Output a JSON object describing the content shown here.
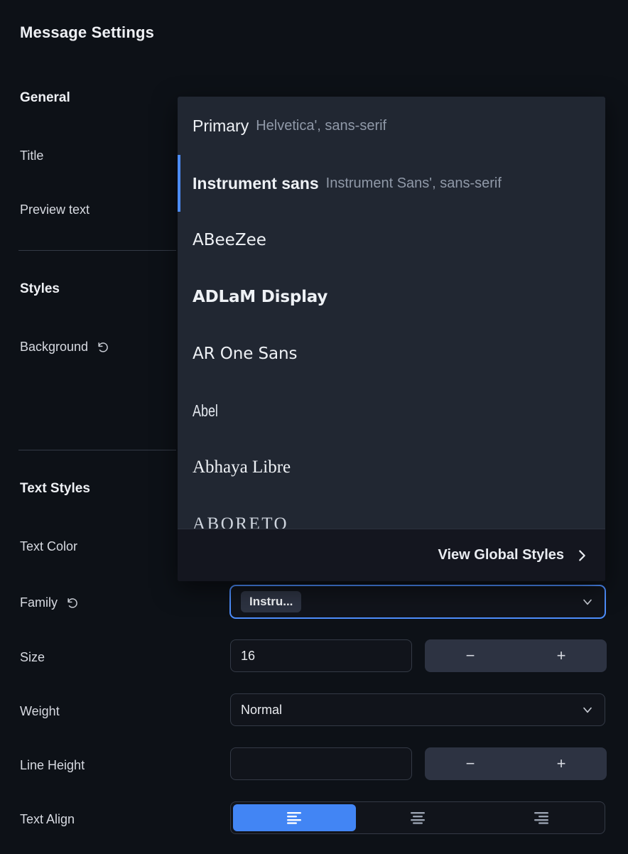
{
  "header": {
    "title": "Message Settings"
  },
  "colors": {
    "page_bg": "#0d1117",
    "panel_bg": "#212732",
    "footer_bg": "#14161f",
    "accent_blue": "#4285f4",
    "focus_blue": "#4d8dfb",
    "stepper_bg": "#2d3342",
    "divider": "#343a46"
  },
  "sections": [
    {
      "heading": "General"
    },
    {
      "heading": "Styles"
    },
    {
      "heading": "Text Styles"
    }
  ],
  "general": {
    "heading": "General",
    "rows": [
      {
        "label": "Title"
      },
      {
        "label": "Preview text"
      }
    ]
  },
  "styles": {
    "heading": "Styles",
    "rows": [
      {
        "label": "Background",
        "reset_icon": "reset-icon"
      }
    ]
  },
  "text_styles": {
    "heading": "Text Styles",
    "rows": {
      "text_color": {
        "label": "Text Color"
      },
      "family": {
        "label": "Family",
        "reset_icon": "reset-icon",
        "chip_value": "Instru...",
        "chevron_icon": "chevron-down-icon"
      },
      "size": {
        "label": "Size",
        "value": "16",
        "minus_label": "−",
        "plus_label": "+"
      },
      "weight": {
        "label": "Weight",
        "value": "Normal",
        "chevron_icon": "chevron-down-icon"
      },
      "line_height": {
        "label": "Line Height",
        "value": "",
        "placeholder": "",
        "minus_label": "−",
        "plus_label": "+"
      },
      "text_align": {
        "label": "Text Align",
        "options": [
          {
            "name": "align-left-icon",
            "active": true
          },
          {
            "name": "align-center-icon",
            "active": false
          },
          {
            "name": "align-right-icon",
            "active": false
          }
        ]
      }
    }
  },
  "font_dropdown": {
    "items": [
      {
        "name": "Primary",
        "stack": "Helvetica', sans-serif",
        "selected": false
      },
      {
        "name": "Instrument sans",
        "stack": "Instrument Sans', sans-serif",
        "selected": true
      },
      {
        "name": "ABeeZee",
        "stack": "",
        "selected": false
      },
      {
        "name": "ADLaM Display",
        "stack": "",
        "selected": false
      },
      {
        "name": "AR One Sans",
        "stack": "",
        "selected": false
      },
      {
        "name": "Abel",
        "stack": "",
        "selected": false
      },
      {
        "name": "Abhaya Libre",
        "stack": "",
        "selected": false
      },
      {
        "name": "ABORETO",
        "stack": "",
        "selected": false
      }
    ],
    "footer": {
      "label": "View Global Styles",
      "arrow_icon": "chevron-right-icon"
    }
  }
}
